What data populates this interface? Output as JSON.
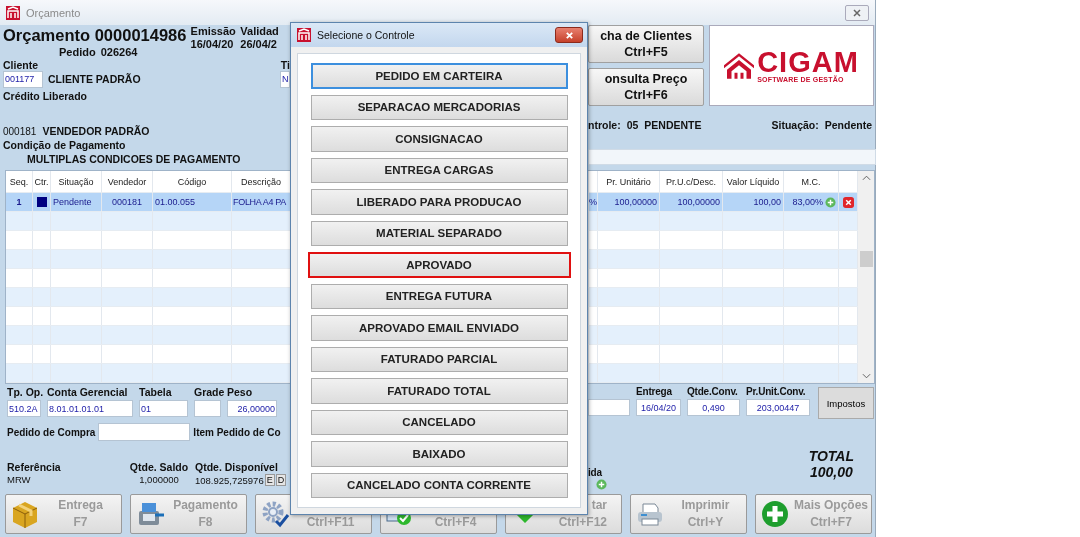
{
  "window": {
    "title": "Orçamento"
  },
  "header": {
    "title": "Orçamento 0000014986",
    "order_label": "Pedido",
    "order": "026264",
    "emission_label": "Emissão",
    "emission": "16/04/20",
    "validity_label": "Validad",
    "validity": "26/04/2",
    "client_label": "Cliente",
    "client_code": "001177",
    "client_name": "CLIENTE PADRÃO",
    "type_label": "Ti",
    "type_value": "N",
    "credit": "Crédito Liberado",
    "seller_code": "000181",
    "seller_name": "VENDEDOR PADRÃO",
    "payment_label": "Condição de Pagamento",
    "payment": "MULTIPLAS CONDICOES DE PAGAMENTO"
  },
  "actions": [
    {
      "label": "cha de Clientes",
      "shortcut": "Ctrl+F5"
    },
    {
      "label": "onsulta Preço",
      "shortcut": "Ctrl+F6"
    }
  ],
  "logo": {
    "name": "CIGAM",
    "tagline": "SOFTWARE DE GESTÃO"
  },
  "status": {
    "control_label": "ntrole:",
    "control": "05",
    "control_state": "PENDENTE",
    "situation_label": "Situação:",
    "situation": "Pendente"
  },
  "table": {
    "left_columns": [
      "Seq.",
      "Ctr.",
      "Situação",
      "Vendedor",
      "Código",
      "Descrição"
    ],
    "right_columns": [
      "Pr. Unitário",
      "Pr.U.c/Desc.",
      "Valor Líquido",
      "M.C."
    ],
    "rows": [
      {
        "selected": true,
        "seq": "1",
        "color": "#000080",
        "situation": "Pendente",
        "seller": "000181",
        "code": "01.00.055",
        "description": "FOLHA A4 PA",
        "column_7": "%",
        "unit_price": "100,00000",
        "discount_price": "100,00000",
        "net_value": "100,00",
        "mc": "83,00%"
      }
    ]
  },
  "fields": [
    {
      "label": "Tp. Op.",
      "value": "510.2A"
    },
    {
      "label": "Conta Gerencial",
      "value": "8.01.01.01.01"
    },
    {
      "label": "Tabela",
      "value": "01"
    },
    {
      "label": "Grade"
    },
    {
      "label": "Peso",
      "value": "26,00000"
    }
  ],
  "right_fields": [
    {
      "label": "Entrega",
      "value": "16/04/20"
    },
    {
      "label": "Qtde.Conv.",
      "value": "0,490"
    },
    {
      "label": "Pr.Unit.Conv.",
      "value": "203,00447"
    }
  ],
  "taxes_button": "Impostos",
  "purchase": {
    "label": "Pedido de Compra",
    "item_label": "Item Pedido de Co"
  },
  "stock": {
    "reference_label": "Referência",
    "reference": "MRW",
    "balance_label": "Qtde. Saldo",
    "balance": "1,000000",
    "available_label": "Qtde. Disponível",
    "available": "108.925,725976",
    "flags": [
      "E",
      "D"
    ]
  },
  "partial_label": "ida",
  "total": {
    "label": "TOTAL",
    "value": "100,00"
  },
  "toolbar": [
    {
      "label": "Entrega",
      "shortcut": "F7",
      "disabled": true
    },
    {
      "label": "Pagamento",
      "shortcut": "F8",
      "disabled": true
    },
    {
      "shortcut": "Ctrl+F11",
      "disabled": true
    },
    {
      "shortcut": "Ctrl+F4",
      "disabled": true
    },
    {
      "label": "tar",
      "shortcut": "Ctrl+F12",
      "disabled": true
    },
    {
      "label": "Imprimir",
      "shortcut": "Ctrl+Y",
      "disabled": true
    },
    {
      "label": "Mais Opções",
      "shortcut": "Ctrl+F7",
      "disabled": true
    }
  ],
  "dialog": {
    "title": "Selecione o Controle",
    "options": [
      {
        "label": "PEDIDO EM CARTEIRA",
        "selected": false,
        "focused": true
      },
      {
        "label": "SEPARACAO MERCADORIAS",
        "selected": false,
        "focused": false
      },
      {
        "label": "CONSIGNACAO",
        "selected": false,
        "focused": false
      },
      {
        "label": "ENTREGA CARGAS",
        "selected": false,
        "focused": false
      },
      {
        "label": "LIBERADO PARA PRODUCAO",
        "selected": false,
        "focused": false
      },
      {
        "label": "MATERIAL SEPARADO",
        "selected": false,
        "focused": false
      },
      {
        "label": "APROVADO",
        "selected": true,
        "focused": false
      },
      {
        "label": "ENTREGA FUTURA",
        "selected": false,
        "focused": false
      },
      {
        "label": "APROVADO EMAIL ENVIADO",
        "selected": false,
        "focused": false
      },
      {
        "label": "FATURADO PARCIAL",
        "selected": false,
        "focused": false
      },
      {
        "label": "FATURADO TOTAL",
        "selected": false,
        "focused": false
      },
      {
        "label": "CANCELADO",
        "selected": false,
        "focused": false
      },
      {
        "label": "BAIXADO",
        "selected": false,
        "focused": false
      },
      {
        "label": "CANCELADO CONTA CORRENTE",
        "selected": false,
        "focused": false
      }
    ]
  }
}
